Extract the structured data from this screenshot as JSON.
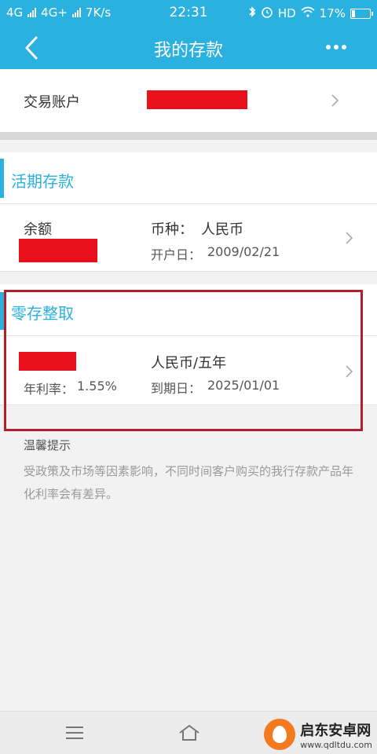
{
  "status_bar": {
    "network1": "4G",
    "network2": "4G+",
    "speed": "7K/s",
    "time": "22:31",
    "hd": "HD",
    "battery": "17%",
    "battery_level": 0.17
  },
  "nav": {
    "title": "我的存款"
  },
  "account": {
    "label": "交易账户"
  },
  "demand_deposit": {
    "title": "活期存款",
    "balance_label": "余额",
    "currency_label": "币种：",
    "currency_value": "人民币",
    "open_date_label": "开户日：",
    "open_date_value": "2009/02/21"
  },
  "installment_deposit": {
    "title": "零存整取",
    "rate_label": "年利率：",
    "rate_value": "1.55%",
    "currency_term": "人民币/五年",
    "due_date_label": "到期日：",
    "due_date_value": "2025/01/01"
  },
  "tips": {
    "title": "温馨提示",
    "text": "受政策及市场等因素影响，不同时间客户购买的我行存款产品年化利率会有差异。"
  },
  "watermark": {
    "name": "启东安卓网",
    "url": "www.qdltdu.com"
  },
  "colors": {
    "accent": "#2bb1e0",
    "redaction": "#e8101b",
    "highlight_border": "#b0202a"
  }
}
